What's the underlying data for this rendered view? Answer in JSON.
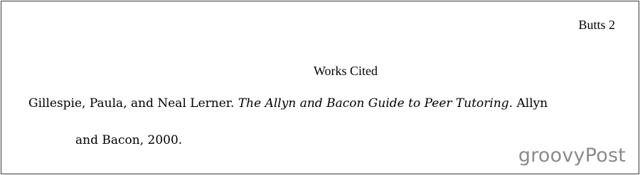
{
  "header": {
    "running_head": "Butts 2"
  },
  "title": "Works Cited",
  "citation": {
    "authors": "Gillespie, Paula, and Neal Lerner. ",
    "book_title": "The Allyn and Bacon Guide to Peer Tutoring",
    "after_title": ". Allyn",
    "line2": "and Bacon, 2000."
  },
  "watermark": "groovyPost"
}
